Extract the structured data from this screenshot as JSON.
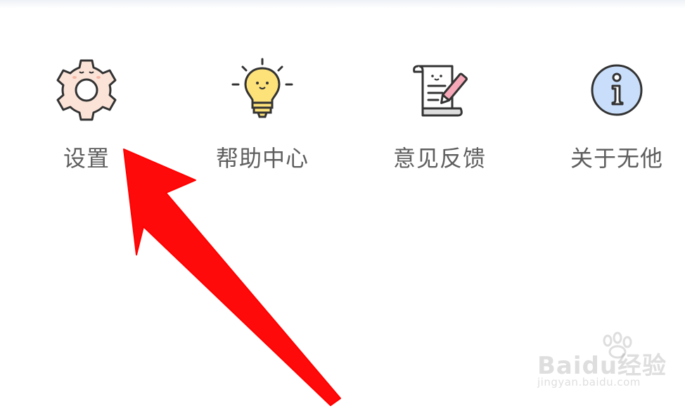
{
  "menu": {
    "items": [
      {
        "label": "设置",
        "icon": "gear-icon"
      },
      {
        "label": "帮助中心",
        "icon": "lightbulb-icon"
      },
      {
        "label": "意见反馈",
        "icon": "feedback-scroll-icon"
      },
      {
        "label": "关于无他",
        "icon": "info-icon"
      }
    ]
  },
  "annotation": {
    "arrow_color": "#ff0000"
  },
  "watermark": {
    "brand": "Baidu经验",
    "url": "jingyan.baidu.com"
  }
}
